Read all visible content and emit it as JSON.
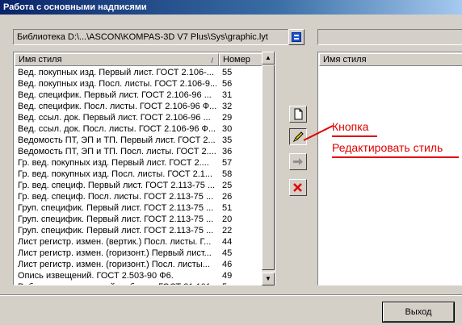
{
  "window": {
    "title": "Работа с основными надписями"
  },
  "library": {
    "label": "Библиотека D:\\...\\ASCON\\KOMPAS-3D V7 Plus\\Sys\\graphic.lyt"
  },
  "left_list": {
    "col_name": "Имя стиля",
    "col_number": "Номер",
    "sort_glyph": "/",
    "rows": [
      {
        "name": "Вед. покупных изд. Первый лист. ГОСТ 2.106-...",
        "number": "55"
      },
      {
        "name": "Вед. покупных изд. Посл. листы. ГОСТ 2.106-9...",
        "number": "56"
      },
      {
        "name": "Вед. специфик. Первый лист. ГОСТ 2.106-96 ...",
        "number": "31"
      },
      {
        "name": "Вед. специфик. Посл. листы. ГОСТ 2.106-96 Ф...",
        "number": "32"
      },
      {
        "name": "Вед. ссыл. док. Первый лист. ГОСТ 2.106-96 ...",
        "number": "29"
      },
      {
        "name": "Вед. ссыл. док. Посл. листы. ГОСТ 2.106-96 Ф...",
        "number": "30"
      },
      {
        "name": "Ведомость ПТ, ЭП и ТП. Первый лист. ГОСТ 2...",
        "number": "35"
      },
      {
        "name": "Ведомость ПТ, ЭП и ТП. Посл. листы. ГОСТ 2....",
        "number": "36"
      },
      {
        "name": "Гр. вед. покупных изд. Первый лист. ГОСТ 2....",
        "number": "57"
      },
      {
        "name": "Гр. вед. покупных изд. Посл. листы. ГОСТ 2.1...",
        "number": "58"
      },
      {
        "name": "Гр. вед. специф. Первый лист. ГОСТ 2.113-75 ...",
        "number": "25"
      },
      {
        "name": "Гр. вед. специф. Посл. листы. ГОСТ 2.113-75 ...",
        "number": "26"
      },
      {
        "name": "Груп. специфик. Первый лист. ГОСТ 2.113-75 ...",
        "number": "51"
      },
      {
        "name": "Груп. специфик. Первый лист. ГОСТ 2.113-75 ...",
        "number": "20"
      },
      {
        "name": "Груп. специфик. Первый лист. ГОСТ 2.113-75 ...",
        "number": "22"
      },
      {
        "name": "Лист регистр. измен. (вертик.) Посл. листы. Г...",
        "number": "44"
      },
      {
        "name": "Лист регистр. измен. (горизонт.) Первый лист...",
        "number": "45"
      },
      {
        "name": "Лист регистр. измен. (горизонт.) Посл. листы...",
        "number": "46"
      },
      {
        "name": "Опись извещений. ГОСТ 2.503-90 Ф6.",
        "number": "49"
      },
      {
        "name": "Рабоч. каталог деталей и сборки. ГОСТ 21.101-...",
        "number": "5"
      }
    ]
  },
  "tools": {
    "new_icon": "new-document-icon",
    "edit_icon": "pencil-icon",
    "copy_icon": "arrow-right-icon",
    "delete_icon": "red-x-icon"
  },
  "right_list": {
    "col_name": "Имя стиля"
  },
  "annotation": {
    "line1": "Кнопка",
    "line2": "Редактировать стиль",
    "color": "#e00000"
  },
  "footer": {
    "exit_label": "Выход"
  }
}
